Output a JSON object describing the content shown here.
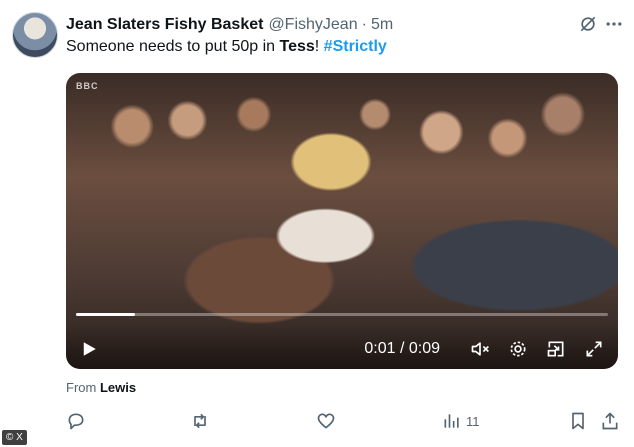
{
  "tweet": {
    "author_name": "Jean Slaters Fishy Basket",
    "handle": "@FishyJean",
    "separator": "·",
    "time": "5m",
    "text_start": "Someone needs to put 50p in ",
    "text_bold": "Tess",
    "text_after": "! ",
    "hashtag": "#Strictly"
  },
  "video": {
    "broadcaster_logo": "BBC",
    "time_readout": "0:01 / 0:09",
    "progress": 0.11
  },
  "source": {
    "prefix": "From ",
    "name": "Lewis"
  },
  "actions": {
    "views_count": "11"
  },
  "watermark": "© X",
  "icons": [
    "grok-icon",
    "more-icon",
    "play-icon",
    "mute-icon",
    "settings-icon",
    "picture-in-picture-icon",
    "fullscreen-icon",
    "reply-icon",
    "retweet-icon",
    "like-icon",
    "views-icon",
    "bookmark-icon",
    "share-icon"
  ]
}
